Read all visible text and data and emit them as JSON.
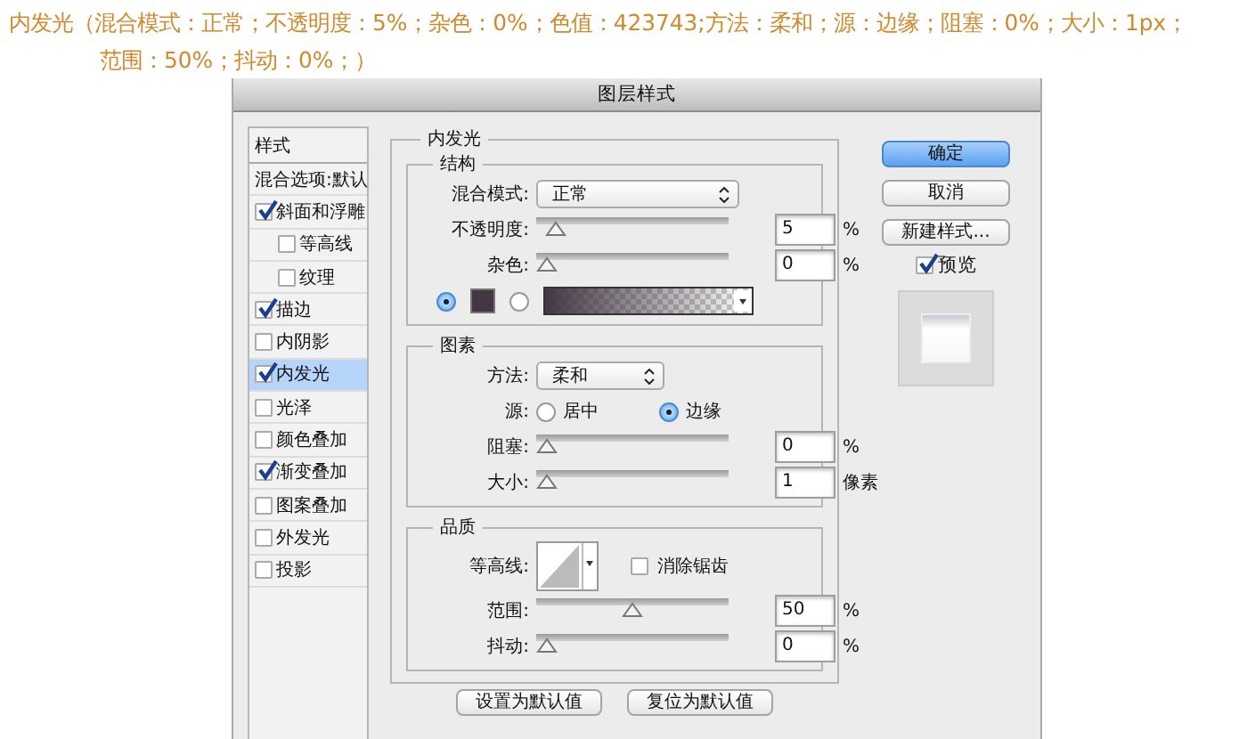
{
  "caption": [
    "内发光（混合模式：正常；不透明度：5%；杂色：0%；色值：423743;方法：柔和；源：边缘；阻塞：0%；大小：1px；",
    "范围：50%；抖动：0%；）"
  ],
  "dialog": {
    "title": "图层样式",
    "styles": [
      {
        "kind": "header",
        "label": "样式",
        "selected": false
      },
      {
        "kind": "blend",
        "label": "混合选项:默认",
        "selected": false
      },
      {
        "kind": "effect",
        "label": "斜面和浮雕",
        "checked": true,
        "selected": false,
        "children": [
          {
            "kind": "effect",
            "label": "等高线",
            "checked": false,
            "selected": false
          },
          {
            "kind": "effect",
            "label": "纹理",
            "checked": false,
            "selected": false
          }
        ]
      },
      {
        "kind": "effect",
        "label": "描边",
        "checked": true,
        "selected": false
      },
      {
        "kind": "effect",
        "label": "内阴影",
        "checked": false,
        "selected": false
      },
      {
        "kind": "effect",
        "label": "内发光",
        "checked": true,
        "selected": true
      },
      {
        "kind": "effect",
        "label": "光泽",
        "checked": false,
        "selected": false
      },
      {
        "kind": "effect",
        "label": "颜色叠加",
        "checked": false,
        "selected": false
      },
      {
        "kind": "effect",
        "label": "渐变叠加",
        "checked": true,
        "selected": false
      },
      {
        "kind": "effect",
        "label": "图案叠加",
        "checked": false,
        "selected": false
      },
      {
        "kind": "effect",
        "label": "外发光",
        "checked": false,
        "selected": false
      },
      {
        "kind": "effect",
        "label": "投影",
        "checked": false,
        "selected": false
      }
    ],
    "panel": {
      "title": "内发光",
      "structure": {
        "title": "结构",
        "blend_mode": {
          "label": "混合模式:",
          "value": "正常"
        },
        "sliders": [
          {
            "label": "不透明度:",
            "level": 0.05,
            "value": "5",
            "unit": "%"
          },
          {
            "label": "杂色:",
            "level": 0,
            "value": "0",
            "unit": "%"
          }
        ],
        "fill": [
          {
            "kind": "solid",
            "selected": true
          },
          {
            "kind": "gradient",
            "selected": false
          }
        ]
      },
      "elements": {
        "title": "图素",
        "technique": {
          "label": "方法:",
          "value": "柔和"
        },
        "source": {
          "label": "源:",
          "options": [
            {
              "label": "居中",
              "selected": false
            },
            {
              "label": "边缘",
              "selected": true
            }
          ]
        },
        "sliders": [
          {
            "label": "阻塞:",
            "level": 0,
            "value": "0",
            "unit": "%"
          },
          {
            "label": "大小:",
            "level": 0.004,
            "value": "1",
            "unit": "像素"
          }
        ]
      },
      "quality": {
        "title": "品质",
        "contour": {
          "label": "等高线:"
        },
        "anti_alias": {
          "label": "消除锯齿",
          "checked": false
        },
        "sliders": [
          {
            "label": "范围:",
            "level": 0.5,
            "value": "50",
            "unit": "%"
          },
          {
            "label": "抖动:",
            "level": 0,
            "value": "0",
            "unit": "%"
          }
        ]
      },
      "buttons": [
        "设置为默认值",
        "复位为默认值"
      ]
    },
    "actions": [
      {
        "kind": "default",
        "label": "确定"
      },
      {
        "kind": "normal",
        "label": "取消"
      },
      {
        "kind": "normal",
        "label": "新建样式..."
      }
    ],
    "preview": {
      "label": "预览",
      "checked": true
    }
  }
}
